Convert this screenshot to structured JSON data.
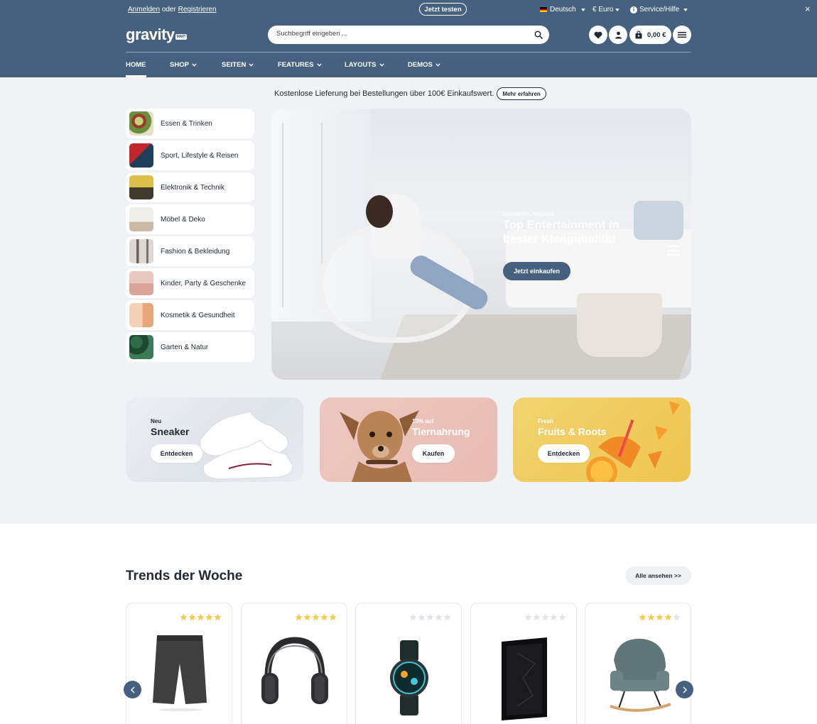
{
  "topbar": {
    "login": "Anmelden",
    "or": "oder",
    "register": "Registrieren",
    "try_button": "Jetzt testen",
    "language": "Deutsch",
    "currency": "€ Euro",
    "service": "Service/Hilfe",
    "close": "×"
  },
  "brand": {
    "name": "gravity",
    "badge": "MART"
  },
  "search": {
    "placeholder": "Suchbegriff eingeben ..."
  },
  "cart": {
    "total": "0,00 €"
  },
  "nav": {
    "items": [
      {
        "label": "HOME"
      },
      {
        "label": "SHOP"
      },
      {
        "label": "SEITEN"
      },
      {
        "label": "FEATURES"
      },
      {
        "label": "LAYOUTS"
      },
      {
        "label": "DEMOS"
      }
    ]
  },
  "promo": {
    "text": "Kostenlose Lieferung bei Bestellungen über 100€ Einkaufswert.",
    "more": "Mehr erfahren"
  },
  "categories": [
    {
      "label": "Essen & Trinken"
    },
    {
      "label": "Sport, Lifestyle & Reisen"
    },
    {
      "label": "Elektronik & Technik"
    },
    {
      "label": "Möbel & Deko"
    },
    {
      "label": "Fashion & Bekleidung"
    },
    {
      "label": "Kinder, Party & Geschenke"
    },
    {
      "label": "Kosmetik & Gesundheit"
    },
    {
      "label": "Garten & Natur"
    }
  ],
  "hero": {
    "small": "Limitiertes Angebot",
    "headline": "Top Entertainment in bester Klangqualität",
    "cta": "Jetzt einkaufen"
  },
  "banners": [
    {
      "small": "Neu",
      "big": "Sneaker",
      "button": "Entdecken"
    },
    {
      "small": "10% auf",
      "big": "Tiernahrung",
      "button": "Kaufen"
    },
    {
      "small": "Fresh",
      "big": "Fruits & Roots",
      "button": "Entdecken"
    }
  ],
  "trends": {
    "title": "Trends der Woche",
    "all_button": "Alle ansehen >>",
    "products": [
      {
        "icon": "shorts-icon",
        "rating": 5
      },
      {
        "icon": "headphones-icon",
        "rating": 5
      },
      {
        "icon": "smartwatch-icon",
        "rating": 0
      },
      {
        "icon": "pc-tower-icon",
        "rating": 0
      },
      {
        "icon": "rocking-chair-icon",
        "rating": 4
      }
    ]
  },
  "colors": {
    "header": "#46617f",
    "page_bg": "#f1f2f6",
    "star": "#f7c948",
    "star_empty": "#e1e3e7"
  }
}
